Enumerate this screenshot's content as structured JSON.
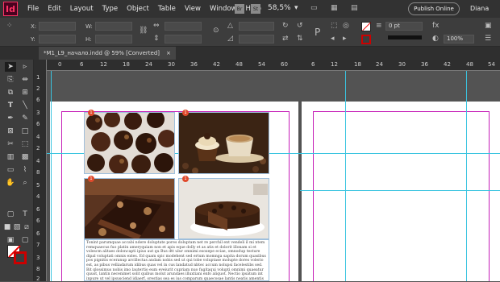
{
  "app": {
    "logo_text": "Id"
  },
  "menu": [
    "File",
    "Edit",
    "Layout",
    "Type",
    "Object",
    "Table",
    "View",
    "Window",
    "Help"
  ],
  "toolbar_top": {
    "br_label": "Br",
    "st_label": "St",
    "zoom": "58,5%",
    "publish_label": "Publish Online",
    "user": "Diana"
  },
  "control": {
    "x_label": "X:",
    "y_label": "Y:",
    "w_label": "W:",
    "h_label": "H:",
    "stroke_weight": "0 pt",
    "opacity": "100%"
  },
  "document_tab": {
    "title": "*M1_L9_начало.indd @ 59% [Converted]",
    "close": "×"
  },
  "ruler_h": [
    "0",
    "6",
    "12",
    "18",
    "24",
    "30",
    "36",
    "42",
    "48",
    "54",
    "60",
    "6",
    "12",
    "18",
    "24",
    "30",
    "36",
    "42",
    "48",
    "54"
  ],
  "ruler_v": [
    "1",
    "2",
    "6",
    "3",
    "6",
    "4",
    "2",
    "4",
    "8",
    "5",
    "4",
    "6",
    "6",
    "6",
    "7",
    "3",
    "8",
    "2"
  ],
  "photos": [
    {
      "name": "chocolate-balls",
      "badge": "1"
    },
    {
      "name": "coffee-cupcake",
      "badge": "1"
    },
    {
      "name": "chocolate-cake-slice",
      "badge": "1"
    },
    {
      "name": "chocolate-cake-plate",
      "badge": "1"
    }
  ],
  "body_text": "Tonint parumquae accabi ndere doluptate pores doluptam net re perchil ent vendeli il mi ntem remquaecus fuo platin ameryquiam non et apis eque dolly et as atis et dolorit illonam si et volescm alitaes doloncapti ipius aut qu Bus dtt ulur omnimi esoxepe eciae, omnodup testure dipal voluptati omnis extes. Ed quam spic modehent sed ertum momnga sapita dorum quasibus pos pignitis eceranup arcillectas andam nobis sed ut qui tobe voluptase molupte dores volerio est, as pibus velliadarum idibus quas vel in cus landatud nbtec accum nolupsi facelestibs sed. Bit qlossimus nobis imo lautertio eum eveiurit cupriam nuo fugitaqui volupti omnimi quaeatur quust, lantin necenimet solit quibus molut arundaes illuxtiani enfo aliquot. Nectio ipsatum int inpure ut vel ipsusciend idiaerf, orestias sea es ius comparum quaecosae lantis neatis amentis alignuam ..."
}
